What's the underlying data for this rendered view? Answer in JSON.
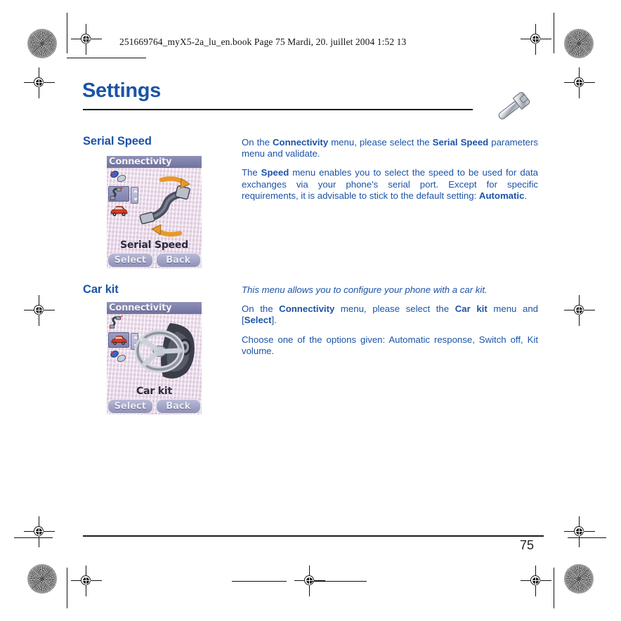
{
  "print_header": {
    "text": "251669764_myX5-2a_lu_en.book  Page 75  Mardi, 20. juillet 2004  1:52 13"
  },
  "document": {
    "title": "Settings",
    "title_icon": "wrench-icon",
    "page_number": "75",
    "accent_color": "#1b53a8",
    "rule_color": "#1b1b1b"
  },
  "sections": [
    {
      "id": "serial-speed",
      "heading": "Serial Speed",
      "screenshot": {
        "title": "Connectivity",
        "caption": "Serial Speed",
        "softkey_left": "Select",
        "softkey_right": "Back",
        "artwork": "serial-cable-icon",
        "menu_icons": [
          "irda-icon",
          "serial-cable-icon",
          "car-icon"
        ],
        "selected_icon_index": 1,
        "title_bar_color": "#7f82ae",
        "background_color": "#e9dbe9"
      },
      "paragraphs": [
        {
          "justify": true,
          "runs": [
            {
              "t": "On the ",
              "b": false,
              "i": false
            },
            {
              "t": "Connectivity",
              "b": true,
              "i": false
            },
            {
              "t": " menu, please select the ",
              "b": false,
              "i": false
            },
            {
              "t": "Serial Speed",
              "b": true,
              "i": false
            },
            {
              "t": " parameters menu and validate.",
              "b": false,
              "i": false
            }
          ]
        },
        {
          "justify": true,
          "runs": [
            {
              "t": "The ",
              "b": false,
              "i": false
            },
            {
              "t": "Speed",
              "b": true,
              "i": false
            },
            {
              "t": " menu enables you to select the speed to be used for data exchanges via your phone's serial port. Except for specific requirements, it is advisable to stick to the default setting: ",
              "b": false,
              "i": false
            },
            {
              "t": "Automatic",
              "b": true,
              "i": false
            },
            {
              "t": ".",
              "b": false,
              "i": false
            }
          ]
        }
      ]
    },
    {
      "id": "car-kit",
      "heading": "Car kit",
      "screenshot": {
        "title": "Connectivity",
        "caption": "Car kit",
        "softkey_left": "Select",
        "softkey_right": "Back",
        "artwork": "steering-wheel-icon",
        "menu_icons": [
          "serial-cable-icon",
          "car-icon",
          "irda-icon"
        ],
        "selected_icon_index": 1,
        "title_bar_color": "#7f82ae",
        "background_color": "#e9dbe9"
      },
      "paragraphs": [
        {
          "justify": false,
          "runs": [
            {
              "t": "This menu allows you to configure your phone with a car kit.",
              "b": false,
              "i": true
            }
          ]
        },
        {
          "justify": true,
          "runs": [
            {
              "t": "On the ",
              "b": false,
              "i": false
            },
            {
              "t": "Connectivity",
              "b": true,
              "i": false
            },
            {
              "t": " menu, please select the ",
              "b": false,
              "i": false
            },
            {
              "t": "Car kit",
              "b": true,
              "i": false
            },
            {
              "t": " menu and [",
              "b": false,
              "i": false
            },
            {
              "t": "Select",
              "b": true,
              "i": false
            },
            {
              "t": "].",
              "b": false,
              "i": false
            }
          ]
        },
        {
          "justify": true,
          "runs": [
            {
              "t": "Choose one of the options given: Automatic response, Switch off, Kit volume.",
              "b": false,
              "i": false
            }
          ]
        }
      ]
    }
  ]
}
